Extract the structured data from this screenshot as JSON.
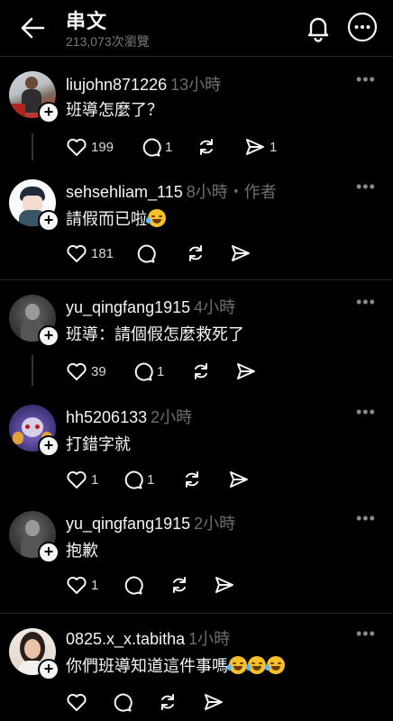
{
  "header": {
    "title": "串文",
    "views": "213,073次瀏覽"
  },
  "comments": [
    {
      "username": "liujohn871226",
      "time": "13小時",
      "author_tag": "",
      "text": "班導怎麼了？",
      "emoji_count": 0,
      "likes": "199",
      "replies": "1",
      "shares": "1"
    },
    {
      "username": "sehsehliam_115",
      "time": "8小時",
      "author_tag": "・作者",
      "text": "請假而已啦",
      "emoji_count": 1,
      "likes": "181",
      "replies": "",
      "shares": ""
    },
    {
      "username": "yu_qingfang1915",
      "time": "4小時",
      "author_tag": "",
      "text": "班導：請個假怎麼救死了",
      "emoji_count": 0,
      "likes": "39",
      "replies": "1",
      "shares": ""
    },
    {
      "username": "hh5206133",
      "time": "2小時",
      "author_tag": "",
      "text": "打錯字就",
      "emoji_count": 0,
      "likes": "1",
      "replies": "1",
      "shares": ""
    },
    {
      "username": "yu_qingfang1915",
      "time": "2小時",
      "author_tag": "",
      "text": "抱歉",
      "emoji_count": 0,
      "likes": "1",
      "replies": "",
      "shares": ""
    },
    {
      "username": "0825.x_x.tabitha",
      "time": "1小時",
      "author_tag": "",
      "text": "你們班導知道這件事嗎",
      "emoji_count": 3,
      "likes": "",
      "replies": "",
      "shares": ""
    }
  ],
  "colors": {
    "background": "#000000",
    "text": "#f3f5f7",
    "muted": "#6e6e6e"
  }
}
